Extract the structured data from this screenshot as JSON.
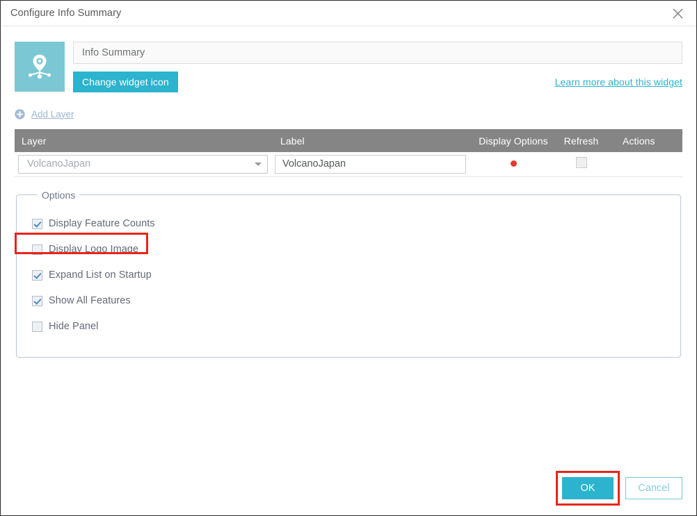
{
  "window": {
    "title": "Configure Info Summary",
    "close_icon": "close-icon"
  },
  "widget": {
    "icon_name": "info-summary-widget-icon",
    "name_value": "Info Summary",
    "name_placeholder": "Info Summary",
    "change_icon_label": "Change widget icon",
    "learn_more_label": "Learn more about this widget",
    "icon_bg_color": "#7bc8d4",
    "accent_color": "#2cb3cd"
  },
  "add_layer": {
    "label": "Add Layer",
    "icon_name": "plus-circle-icon",
    "color": "#9fb6d0"
  },
  "table": {
    "header_bg": "#858585",
    "columns": [
      {
        "key": "layer",
        "label": "Layer"
      },
      {
        "key": "label",
        "label": "Label"
      },
      {
        "key": "display_options",
        "label": "Display Options"
      },
      {
        "key": "refresh",
        "label": "Refresh"
      },
      {
        "key": "actions",
        "label": "Actions"
      }
    ],
    "rows": [
      {
        "layer_selected": "VolcanoJapan",
        "label_value": "VolcanoJapan",
        "display_options_marker": "red-dot",
        "display_options_color": "#e03b2f",
        "refresh_checked": false,
        "actions": ""
      }
    ]
  },
  "options": {
    "legend": "Options",
    "items": [
      {
        "label": "Display Feature Counts",
        "checked": true,
        "highlighted": true
      },
      {
        "label": "Display Logo Image",
        "checked": false,
        "highlighted": false
      },
      {
        "label": "Expand List on Startup",
        "checked": true,
        "highlighted": false
      },
      {
        "label": "Show All Features",
        "checked": true,
        "highlighted": false
      },
      {
        "label": "Hide Panel",
        "checked": false,
        "highlighted": false
      }
    ]
  },
  "footer": {
    "ok_label": "OK",
    "cancel_label": "Cancel",
    "ok_highlighted": true,
    "highlight_color": "#e8241a"
  }
}
